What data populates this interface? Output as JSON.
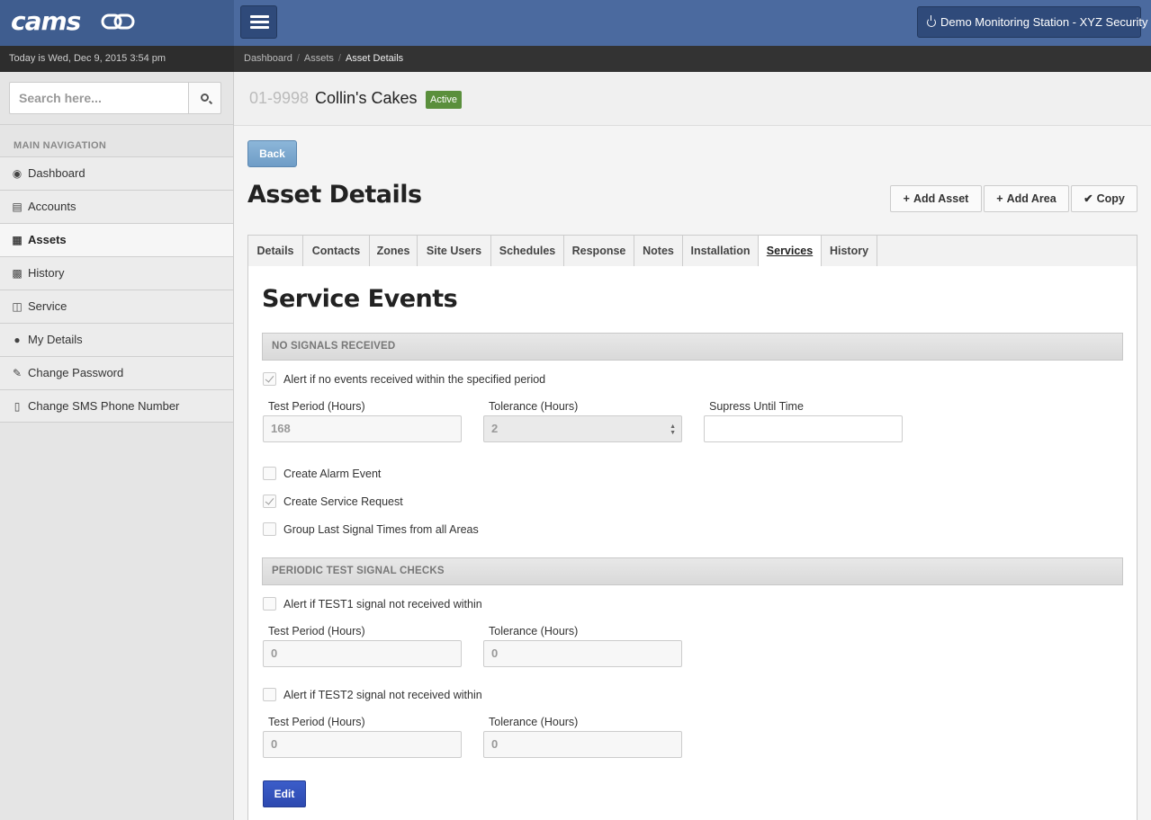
{
  "header": {
    "logo_text": "cams",
    "station_label": "Demo Monitoring Station - XYZ Security"
  },
  "datebar": {
    "text": "Today is Wed, Dec 9, 2015 3:54 pm"
  },
  "breadcrumb": [
    "Dashboard",
    "Assets",
    "Asset Details"
  ],
  "sidebar": {
    "search_placeholder": "Search here...",
    "nav_title": "MAIN NAVIGATION",
    "items": [
      {
        "label": "Dashboard",
        "icon": "dashboard-icon"
      },
      {
        "label": "Accounts",
        "icon": "book-icon"
      },
      {
        "label": "Assets",
        "icon": "building-icon",
        "active": true
      },
      {
        "label": "History",
        "icon": "calendar-icon"
      },
      {
        "label": "Service",
        "icon": "medkit-icon"
      },
      {
        "label": "My Details",
        "icon": "user-icon"
      },
      {
        "label": "Change Password",
        "icon": "edit-icon"
      },
      {
        "label": "Change SMS Phone Number",
        "icon": "mobile-icon"
      }
    ]
  },
  "account": {
    "id": "01-9998",
    "name": "Collin's Cakes",
    "status": "Active"
  },
  "page": {
    "back_label": "Back",
    "title": "Asset Details",
    "add_asset_label": "Add Asset",
    "add_area_label": "Add Area",
    "copy_label": "Copy"
  },
  "tabs": [
    "Details",
    "Contacts",
    "Zones",
    "Site Users",
    "Schedules",
    "Response",
    "Notes",
    "Installation",
    "Services",
    "History"
  ],
  "active_tab": "Services",
  "service_events": {
    "title": "Service Events",
    "no_signals": {
      "heading": "NO SIGNALS RECEIVED",
      "alert_label": "Alert if no events received within the specified period",
      "alert_checked": true,
      "test_period_label": "Test Period (Hours)",
      "test_period_value": "168",
      "tolerance_label": "Tolerance (Hours)",
      "tolerance_value": "2",
      "suppress_label": "Supress Until Time",
      "suppress_value": "",
      "create_alarm_label": "Create Alarm Event",
      "create_alarm_checked": false,
      "create_service_label": "Create Service Request",
      "create_service_checked": true,
      "group_last_label": "Group Last Signal Times from all Areas",
      "group_last_checked": false
    },
    "periodic": {
      "heading": "PERIODIC TEST SIGNAL CHECKS",
      "test1_label": "Alert if TEST1 signal not received within",
      "test1_checked": false,
      "test1_period_label": "Test Period (Hours)",
      "test1_period_value": "0",
      "test1_tolerance_label": "Tolerance (Hours)",
      "test1_tolerance_value": "0",
      "test2_label": "Alert if TEST2 signal not received within",
      "test2_checked": false,
      "test2_period_label": "Test Period (Hours)",
      "test2_period_value": "0",
      "test2_tolerance_label": "Tolerance (Hours)",
      "test2_tolerance_value": "0"
    },
    "edit_label": "Edit"
  },
  "colors": {
    "topbar": "#4b6a9f",
    "active_badge": "#5a8f3c",
    "edit_button": "#2d49b0",
    "back_button": "#7aa6cf"
  }
}
